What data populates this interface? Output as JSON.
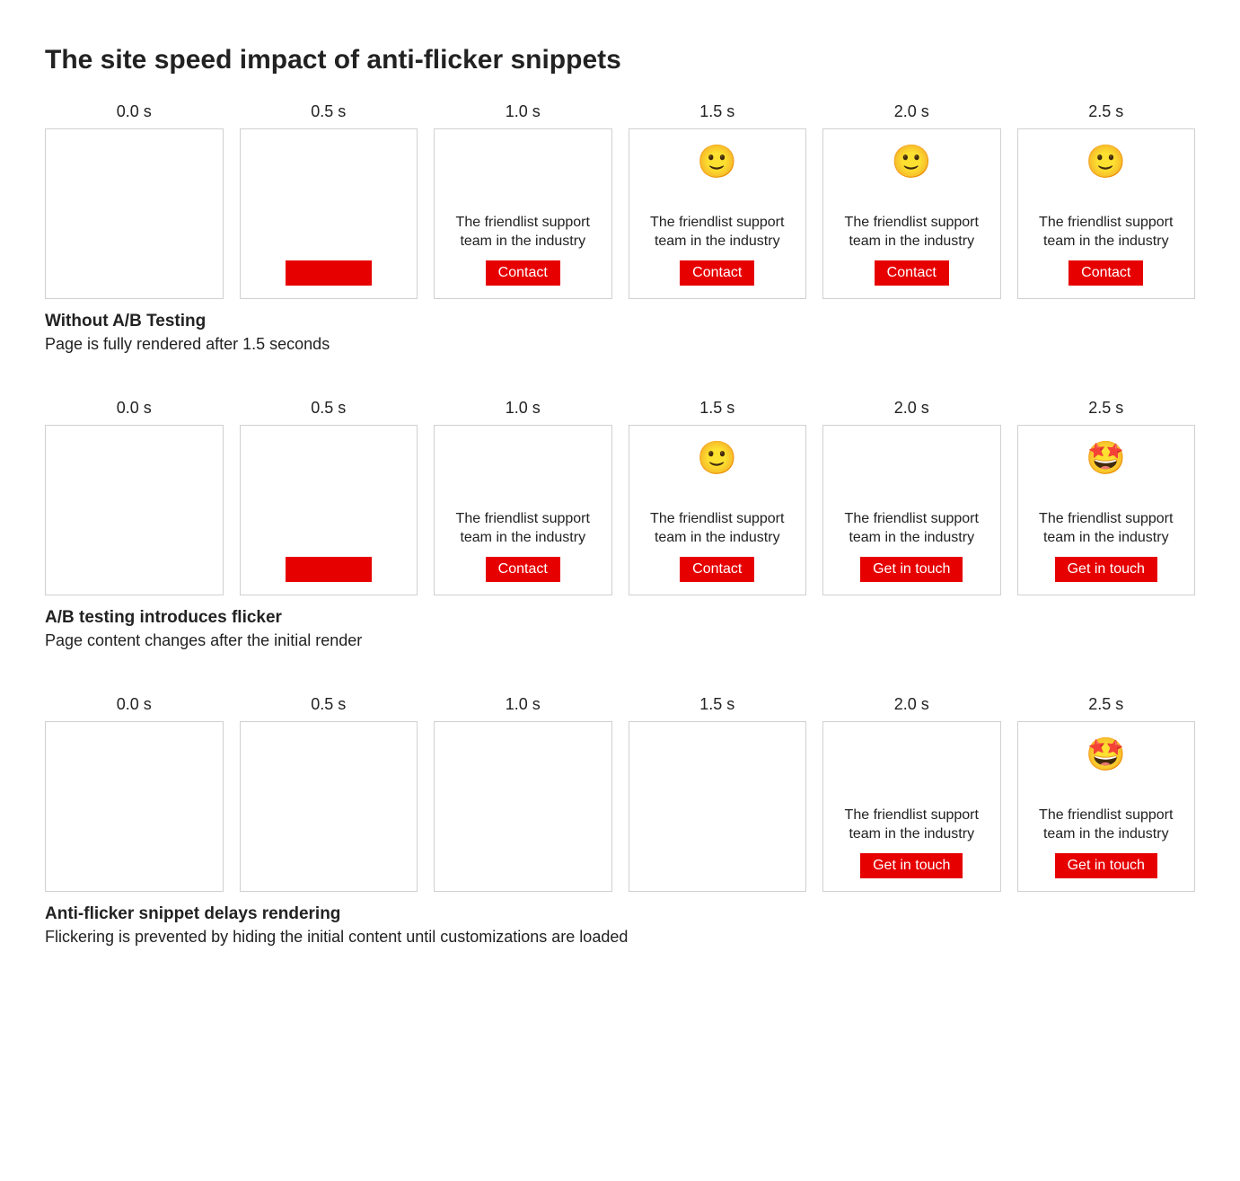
{
  "title": "The site speed impact of anti-flicker snippets",
  "time_labels": [
    "0.0 s",
    "0.5 s",
    "1.0 s",
    "1.5 s",
    "2.0 s",
    "2.5 s"
  ],
  "rows": [
    {
      "heading": "Without A/B Testing",
      "desc": "Page is fully rendered after 1.5 seconds",
      "frames": [
        {
          "icon": "",
          "text": "",
          "button": ""
        },
        {
          "icon": "",
          "text": "",
          "button": "blank"
        },
        {
          "icon": "",
          "text": "The friendlist support team in the industry",
          "button": "Contact"
        },
        {
          "icon": "🙂",
          "text": "The friendlist support team in the industry",
          "button": "Contact"
        },
        {
          "icon": "🙂",
          "text": "The friendlist support team in the industry",
          "button": "Contact"
        },
        {
          "icon": "🙂",
          "text": "The friendlist support team in the industry",
          "button": "Contact"
        }
      ]
    },
    {
      "heading": "A/B testing introduces flicker",
      "desc": "Page content changes after the initial render",
      "frames": [
        {
          "icon": "",
          "text": "",
          "button": ""
        },
        {
          "icon": "",
          "text": "",
          "button": "blank"
        },
        {
          "icon": "",
          "text": "The friendlist support team in the industry",
          "button": "Contact"
        },
        {
          "icon": "🙂",
          "text": "The friendlist support team in the industry",
          "button": "Contact"
        },
        {
          "icon": "",
          "text": "The friendlist support team in the industry",
          "button": "Get in touch"
        },
        {
          "icon": "🤩",
          "text": "The friendlist support team in the industry",
          "button": "Get in touch"
        }
      ]
    },
    {
      "heading": "Anti-flicker snippet delays rendering",
      "desc": "Flickering is prevented by hiding the initial content until customizations are loaded",
      "frames": [
        {
          "icon": "",
          "text": "",
          "button": ""
        },
        {
          "icon": "",
          "text": "",
          "button": ""
        },
        {
          "icon": "",
          "text": "",
          "button": ""
        },
        {
          "icon": "",
          "text": "",
          "button": ""
        },
        {
          "icon": "",
          "text": "The friendlist support team in the industry",
          "button": "Get in touch"
        },
        {
          "icon": "🤩",
          "text": "The friendlist support team in the industry",
          "button": "Get in touch"
        }
      ]
    }
  ]
}
